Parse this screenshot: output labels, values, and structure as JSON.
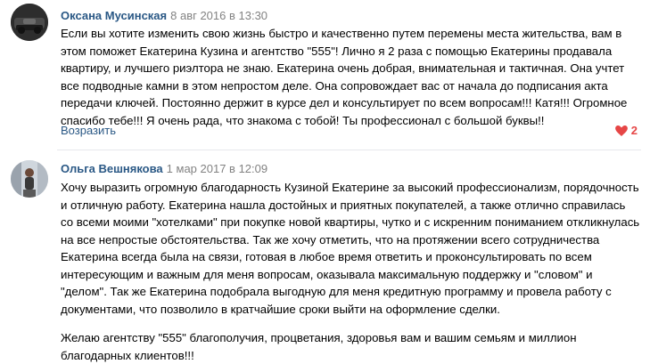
{
  "comments": [
    {
      "author": "Оксана Мусинская",
      "date": "8 авг 2016 в 13:30",
      "paragraphs": [
        "Если вы хотите изменить свою жизнь быстро и качественно путем перемены места жительства, вам в этом поможет Екатерина Кузина и агентство \"555\"! Лично я 2 раза с помощью Екатерины продавала квартиру, и лучшего риэлтора не знаю. Екатерина очень добрая, внимательная и тактичная. Она учтет все подводные камни в этом непростом деле. Она сопровождает вас от начала до подписания акта передачи ключей. Постоянно держит в курсе дел и консультирует по всем вопросам!!! Катя!!! Огромное спасибо тебе!!! Я очень рада, что знакома с тобой! Ты профессионал с большой буквы!!"
      ],
      "reply_label": "Возразить",
      "likes": "2"
    },
    {
      "author": "Ольга Вешнякова",
      "date": "1 мар 2017 в 12:09",
      "paragraphs": [
        "Хочу выразить огромную благодарность Кузиной Екатерине за высокий профессионализм, порядочность и отличную работу. Екатерина нашла достойных и приятных покупателей, а также отлично справилась со всеми моими \"хотелками\" при покупке новой квартиры, чутко и с искренним пониманием откликнулась на все непростые обстоятельства. Так же хочу отметить, что на протяжении всего сотрудничества Екатерина всегда была на связи, готовая в любое время ответить и проконсультировать по всем интересующим и важным для меня вопросам, оказывала максимальную поддержку и \"словом\" и \"делом\". Так же Екатерина подобрала выгодную для меня кредитную программу и провела работу с документами, что позволило в кратчайшие сроки выйти на оформление сделки.",
        "Желаю агентству \"555\" благополучия, процветания, здоровья вам и вашим семьям и миллион благодарных клиентов!!!"
      ]
    }
  ],
  "colors": {
    "author": "#2a5885",
    "date": "#828282",
    "like": "#e64646"
  },
  "icons": {
    "like": "heart-icon"
  }
}
